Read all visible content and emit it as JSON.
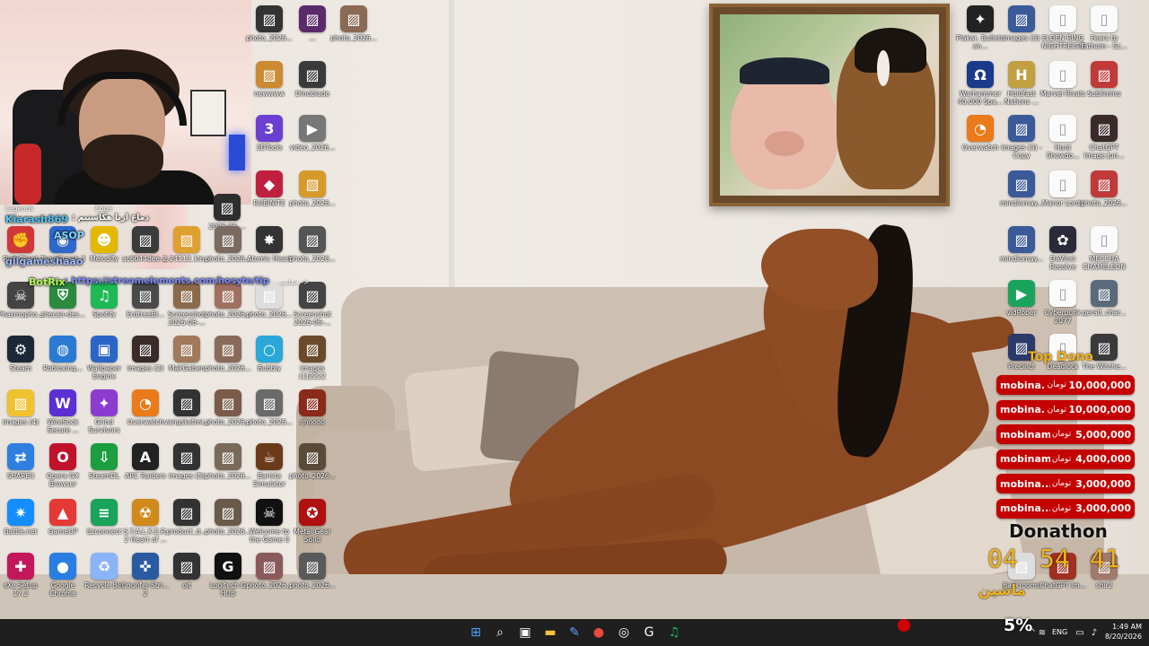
{
  "colors": {
    "taskbar": "#1f1f1f",
    "dono_row": "#c40000",
    "gold": "#f3b21b"
  },
  "webcam": {
    "poster_label": "Legends",
    "poster_label2": "Edge"
  },
  "chat": {
    "line1_name": "Kiarash869",
    "line1_text": ": دماغ اریا هکاستیم",
    "line2_name": "ASOP",
    "line3_name": "gilgameshaao",
    "line4_name": "BotRix",
    "line4_text": ": https://streamelements.com/hosyte/tip",
    "line4_extra": "حمایت ->"
  },
  "desktop_icons": [
    {
      "label": "photo_2026...",
      "icon": "image-icon",
      "color": "#333"
    },
    {
      "label": "...",
      "icon": "image-icon",
      "color": "#5a2a6a"
    },
    {
      "label": "photo_2026...",
      "icon": "image-icon",
      "color": "#8a6a55"
    },
    {
      "label": "newwww",
      "icon": "image-icon",
      "color": "#cc8a33"
    },
    {
      "label": "Dinoblade",
      "icon": "image-icon",
      "color": "#3a3a3a"
    },
    {
      "label": "3DTools",
      "icon": "3d-icon",
      "color": "#6b3fd1"
    },
    {
      "label": "video_2026...",
      "icon": "video-icon",
      "color": "#777"
    },
    {
      "label": "RUBINITE",
      "icon": "app-icon",
      "color": "#c02040"
    },
    {
      "label": "photo_2026...",
      "icon": "image-icon",
      "color": "#d79a2a"
    },
    {
      "label": "2026-06-...",
      "icon": "image-icon",
      "color": "#2e2e2e"
    },
    {
      "label": "Riot Client",
      "icon": "riot-icon",
      "color": "#d13639"
    },
    {
      "label": "TeamSpeak 3",
      "icon": "teamspeak-icon",
      "color": "#2f68c9"
    },
    {
      "label": "Melodify",
      "icon": "melodify-icon",
      "color": "#e5b800"
    },
    {
      "label": "Phasmopho...",
      "icon": "ghost-icon",
      "color": "#444"
    },
    {
      "label": "shecan-des...",
      "icon": "shield-icon",
      "color": "#2b8a3e"
    },
    {
      "label": "Spotify",
      "icon": "spotify-icon",
      "color": "#1db954"
    },
    {
      "label": "Steam",
      "icon": "steam-icon",
      "color": "#1b2838"
    },
    {
      "label": "Robloxing...",
      "icon": "earth-icon",
      "color": "#2a7ad3"
    },
    {
      "label": "Wallpaper Engine",
      "icon": "wallpaper-icon",
      "color": "#2a66c6"
    },
    {
      "label": "images (4)",
      "icon": "image-icon",
      "color": "#f0c230"
    },
    {
      "label": "WireSock Secure ...",
      "icon": "wiresock-icon",
      "color": "#5b2fd1"
    },
    {
      "label": "Grind Survivors",
      "icon": "game-icon",
      "color": "#8c3bd1"
    },
    {
      "label": "SHAREit",
      "icon": "shareit-icon",
      "color": "#2f7fe0"
    },
    {
      "label": "Opera GX Browser",
      "icon": "opera-icon",
      "color": "#c0122b"
    },
    {
      "label": "SteamDL",
      "icon": "steamdl-icon",
      "color": "#1a9e3f"
    },
    {
      "label": "Battle.net",
      "icon": "battlenet-icon",
      "color": "#148eff"
    },
    {
      "label": "GameUP",
      "icon": "gameup-icon",
      "color": "#e53935"
    },
    {
      "label": "Ezconnect",
      "icon": "ezconnect-icon",
      "color": "#1aa35b"
    },
    {
      "label": "sXe Setup 17.2",
      "icon": "sxe-icon",
      "color": "#c2185b"
    },
    {
      "label": "Google Chrome",
      "icon": "chrome-icon",
      "color": "#2a7de1"
    },
    {
      "label": "Recycle Bin",
      "icon": "recycle-bin-icon",
      "color": "#8ab4f8"
    },
    {
      "label": "ac6044dee-...",
      "icon": "image-icon",
      "color": "#3b3b3b"
    },
    {
      "label": "2-24113_kin...",
      "icon": "image-icon",
      "color": "#e0a030"
    },
    {
      "label": "photo_2026...",
      "icon": "image-icon",
      "color": "#7a6a60"
    },
    {
      "label": "Atomic Heart",
      "icon": "atomic-heart-icon",
      "color": "#333"
    },
    {
      "label": "photo_2026...",
      "icon": "image-icon",
      "color": "#555"
    },
    {
      "label": "ErdtreeBl...",
      "icon": "image-icon",
      "color": "#4a4a4a"
    },
    {
      "label": "Screenshot 2026-06-...",
      "icon": "image-icon",
      "color": "#8a6a4a"
    },
    {
      "label": "photo_2026...",
      "icon": "image-icon",
      "color": "#a07060"
    },
    {
      "label": "photo_2026...",
      "icon": "image-icon",
      "color": "#ddd"
    },
    {
      "label": "Screenshot 2026-06-...",
      "icon": "image-icon",
      "color": "#444"
    },
    {
      "label": "images (2)",
      "icon": "image-icon",
      "color": "#3a2a2a"
    },
    {
      "label": "MakGaben",
      "icon": "image-icon",
      "color": "#a07a5a"
    },
    {
      "label": "photo_2026...",
      "icon": "image-icon",
      "color": "#8a6a5a"
    },
    {
      "label": "Bubbly",
      "icon": "bubbly-icon",
      "color": "#2aa8d8"
    },
    {
      "label": "images (1)2222",
      "icon": "image-icon",
      "color": "#6a4a2a"
    },
    {
      "label": "Overwatch",
      "icon": "overwatch-icon",
      "color": "#ea7a1a"
    },
    {
      "label": "vangsketmi...",
      "icon": "image-icon",
      "color": "#333"
    },
    {
      "label": "photo_2026...",
      "icon": "image-icon",
      "color": "#7a5a4a"
    },
    {
      "label": "photo_2026...",
      "icon": "image-icon",
      "color": "#6a6a6a"
    },
    {
      "label": "ghoooo",
      "icon": "image-icon",
      "color": "#8a2a1a"
    },
    {
      "label": "ARC Raiders",
      "icon": "arc-icon",
      "color": "#222"
    },
    {
      "label": "images (5)",
      "icon": "image-icon",
      "color": "#333"
    },
    {
      "label": "photo_2026...",
      "icon": "image-icon",
      "color": "#7a6a5a"
    },
    {
      "label": "Barista Simulator",
      "icon": "coffee-icon",
      "color": "#6a3a1a"
    },
    {
      "label": "photo_2026...",
      "icon": "image-icon",
      "color": "#5a4a3a"
    },
    {
      "label": "S.T.A.L.K.E.R. 2 Heart of ...",
      "icon": "stalker-icon",
      "color": "#d08a1a"
    },
    {
      "label": "product_d...",
      "icon": "image-icon",
      "color": "#333"
    },
    {
      "label": "photo_2026...",
      "icon": "image-icon",
      "color": "#6a5a4a"
    },
    {
      "label": "Welcome to the Game II",
      "icon": "skull-icon",
      "color": "#111"
    },
    {
      "label": "Metal Gear Solid",
      "icon": "mgs-icon",
      "color": "#b01010"
    },
    {
      "label": "Counter-Stri... 2",
      "icon": "cs2-icon",
      "color": "#2a5aa0"
    },
    {
      "label": "ojt",
      "icon": "image-icon",
      "color": "#333"
    },
    {
      "label": "Logitech G HUB",
      "icon": "logitech-icon",
      "color": "#111"
    },
    {
      "label": "photo_2026...",
      "icon": "image-icon",
      "color": "#8a5a5a"
    },
    {
      "label": "photo_2026...",
      "icon": "image-icon",
      "color": "#5a5a5a"
    },
    {
      "label": "Plakar, Bullets an...",
      "icon": "game-icon",
      "color": "#222"
    },
    {
      "label": "images (3)",
      "icon": "image-icon",
      "color": "#3a5a9a"
    },
    {
      "label": "ELDEN RING NIGHTREIGN",
      "icon": "file-icon",
      "color": "#f3f3f3"
    },
    {
      "label": "Fears to Fathom - Sc...",
      "icon": "file-icon",
      "color": "#f3f3f3"
    },
    {
      "label": "Warhammer 40,000 Spa...",
      "icon": "warhammer-icon",
      "color": "#1a3a8a"
    },
    {
      "label": "Holdfast Nations ...",
      "icon": "holdfast-icon",
      "color": "#c0a040"
    },
    {
      "label": "Marvel Rivals",
      "icon": "file-icon",
      "color": "#f3f3f3"
    },
    {
      "label": "Sublimino",
      "icon": "image-icon",
      "color": "#c03a3a"
    },
    {
      "label": "Overwatch",
      "icon": "overwatch-icon",
      "color": "#ea7a1a"
    },
    {
      "label": "images (3) - Copy",
      "icon": "image-icon",
      "color": "#3a5a9a"
    },
    {
      "label": "Hunt Showdo...",
      "icon": "file-icon",
      "color": "#f3f3f3"
    },
    {
      "label": "ChatGPT Image Jun...",
      "icon": "image-icon",
      "color": "#3a2a2a"
    },
    {
      "label": "mindiomay...",
      "icon": "image-icon",
      "color": "#3a5a9a"
    },
    {
      "label": "Manor Lords",
      "icon": "file-icon",
      "color": "#f3f3f3"
    },
    {
      "label": "photo_2026...",
      "icon": "image-icon",
      "color": "#c03a3a"
    },
    {
      "label": "mindiomay...",
      "icon": "image-icon",
      "color": "#3a5a9a"
    },
    {
      "label": "DaVinci Resolve",
      "icon": "davinci-icon",
      "color": "#2a2a3a"
    },
    {
      "label": "MECCHA CHAMELEON",
      "icon": "file-icon",
      "color": "#f3f3f3"
    },
    {
      "label": "vidRober",
      "icon": "vidrober-icon",
      "color": "#1aa35b"
    },
    {
      "label": "Cyberpunk 2077",
      "icon": "file-icon",
      "color": "#f3f3f3"
    },
    {
      "label": "geralt_char...",
      "icon": "image-icon",
      "color": "#5a6a7a"
    },
    {
      "label": "Precinct",
      "icon": "image-icon",
      "color": "#2a3a6a"
    },
    {
      "label": "Deadlock",
      "icon": "file-icon",
      "color": "#f3f3f3"
    },
    {
      "label": "The Witche...",
      "icon": "image-icon",
      "color": "#3a3a3a"
    },
    {
      "label": "Backrooms",
      "icon": "image-icon",
      "color": "#ddd"
    },
    {
      "label": "ChatGPT Im...",
      "icon": "image-icon",
      "color": "#a03020"
    },
    {
      "label": "shir2",
      "icon": "image-icon",
      "color": "#a07a6a"
    }
  ],
  "top_dono": {
    "title": "Top Dono",
    "currency": "تومان",
    "rows": [
      {
        "name": "mobina...",
        "amount": "10,000,000"
      },
      {
        "name": "mobina...",
        "amount": "10,000,000"
      },
      {
        "name": "mobinam...",
        "amount": "5,000,000"
      },
      {
        "name": "mobinam...",
        "amount": "4,000,000"
      },
      {
        "name": "mobina...",
        "amount": "3,000,000"
      },
      {
        "name": "mobina...",
        "amount": "3,000,000"
      }
    ]
  },
  "donathon": {
    "title": "Donathon",
    "hours": "04",
    "minutes": "54",
    "seconds": "41",
    "subtitle": "ماشین"
  },
  "percent": "5%",
  "taskbar": {
    "items": [
      "start-icon",
      "search-icon",
      "task-view-icon",
      "file-explorer-icon",
      "pen-icon",
      "chrome-icon",
      "obs-icon",
      "logitech-icon",
      "spotify-icon"
    ],
    "lang": "ENG",
    "time": "1:49 AM",
    "date": "8/20/2026"
  }
}
